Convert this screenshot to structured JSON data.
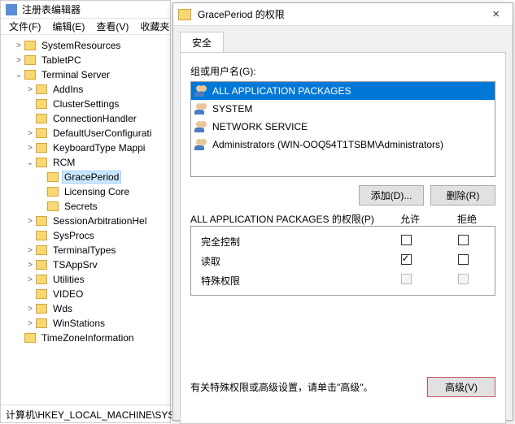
{
  "regedit": {
    "title": "注册表编辑器",
    "menu": [
      "文件(F)",
      "编辑(E)",
      "查看(V)",
      "收藏夹"
    ],
    "tree": [
      {
        "ind": 1,
        "exp": ">",
        "label": "SystemResources"
      },
      {
        "ind": 1,
        "exp": ">",
        "label": "TabletPC"
      },
      {
        "ind": 1,
        "exp": "v",
        "label": "Terminal Server"
      },
      {
        "ind": 2,
        "exp": ">",
        "label": "AddIns"
      },
      {
        "ind": 2,
        "exp": "",
        "label": "ClusterSettings"
      },
      {
        "ind": 2,
        "exp": "",
        "label": "ConnectionHandler"
      },
      {
        "ind": 2,
        "exp": ">",
        "label": "DefaultUserConfigurati"
      },
      {
        "ind": 2,
        "exp": ">",
        "label": "KeyboardType Mappi"
      },
      {
        "ind": 2,
        "exp": "v",
        "label": "RCM"
      },
      {
        "ind": 3,
        "exp": "",
        "label": "GracePeriod",
        "selected": true
      },
      {
        "ind": 3,
        "exp": "",
        "label": "Licensing Core"
      },
      {
        "ind": 3,
        "exp": "",
        "label": "Secrets"
      },
      {
        "ind": 2,
        "exp": ">",
        "label": "SessionArbitrationHel"
      },
      {
        "ind": 2,
        "exp": "",
        "label": "SysProcs"
      },
      {
        "ind": 2,
        "exp": ">",
        "label": "TerminalTypes"
      },
      {
        "ind": 2,
        "exp": ">",
        "label": "TSAppSrv"
      },
      {
        "ind": 2,
        "exp": ">",
        "label": "Utilities"
      },
      {
        "ind": 2,
        "exp": "",
        "label": "VIDEO"
      },
      {
        "ind": 2,
        "exp": ">",
        "label": "Wds"
      },
      {
        "ind": 2,
        "exp": ">",
        "label": "WinStations"
      },
      {
        "ind": 1,
        "exp": "",
        "label": "TimeZoneInformation"
      }
    ],
    "status": "计算机\\HKEY_LOCAL_MACHINE\\SYS"
  },
  "dialog": {
    "title": "GracePeriod 的权限",
    "close": "×",
    "tab": "安全",
    "group_label": "组或用户名(G):",
    "users": [
      {
        "name": "ALL APPLICATION PACKAGES",
        "selected": true,
        "group": true
      },
      {
        "name": "SYSTEM",
        "group": true
      },
      {
        "name": "NETWORK SERVICE",
        "group": true
      },
      {
        "name": "Administrators (WIN-OOQ54T1TSBM\\Administrators)",
        "group": true
      }
    ],
    "add": "添加(D)...",
    "remove": "删除(R)",
    "perm_for": "ALL APPLICATION PACKAGES 的权限(P)",
    "col_allow": "允许",
    "col_deny": "拒绝",
    "perms": [
      {
        "name": "完全控制",
        "allow": false,
        "deny": false,
        "disabled": false
      },
      {
        "name": "读取",
        "allow": true,
        "deny": false,
        "disabled": false
      },
      {
        "name": "特殊权限",
        "allow": false,
        "deny": false,
        "disabled": true
      }
    ],
    "adv_text": "有关特殊权限或高级设置，请单击\"高级\"。",
    "adv_btn": "高级(V)"
  }
}
